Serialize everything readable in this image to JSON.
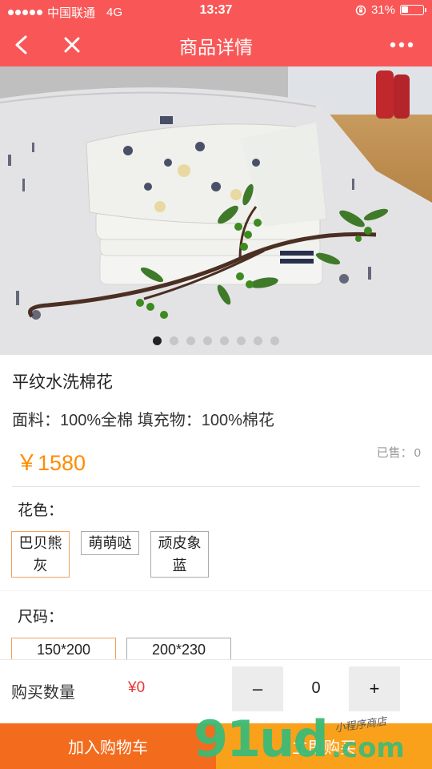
{
  "status_bar": {
    "carrier": "中国联通",
    "network": "4G",
    "time": "13:37",
    "battery_percent": "31%",
    "battery_level": 0.31
  },
  "nav": {
    "title": "商品详情",
    "back_icon": "back-arrow-icon",
    "close_icon": "close-icon",
    "more_icon": "more-icon"
  },
  "carousel": {
    "page_count": 8,
    "active_index": 0
  },
  "product": {
    "name": "平纹水洗棉花",
    "material": "面料：100%全棉 填充物：100%棉花",
    "price": "￥1580",
    "sold_label": "已售：",
    "sold_count": "0"
  },
  "color_section": {
    "label": "花色：",
    "options": [
      "巴贝熊灰",
      "萌萌哒",
      "顽皮象蓝"
    ],
    "selected_index": 0
  },
  "size_section": {
    "label": "尺码：",
    "options": [
      "150*200",
      "200*230"
    ],
    "selected_index": 0
  },
  "quantity": {
    "label": "购买数量",
    "total": "¥0",
    "minus": "–",
    "value": "0",
    "plus": "+"
  },
  "actions": {
    "add_to_cart": "加入购物车",
    "buy_now": "立即购买"
  },
  "watermark": {
    "main": "91ud",
    "suffix": ".com",
    "small": "小程序商店"
  },
  "colors": {
    "header_red": "#f95757",
    "price_orange": "#ff8c00",
    "cart_orange": "#f36b1c",
    "buy_yellow": "#f9a11b",
    "selected_border": "#f0a060"
  }
}
